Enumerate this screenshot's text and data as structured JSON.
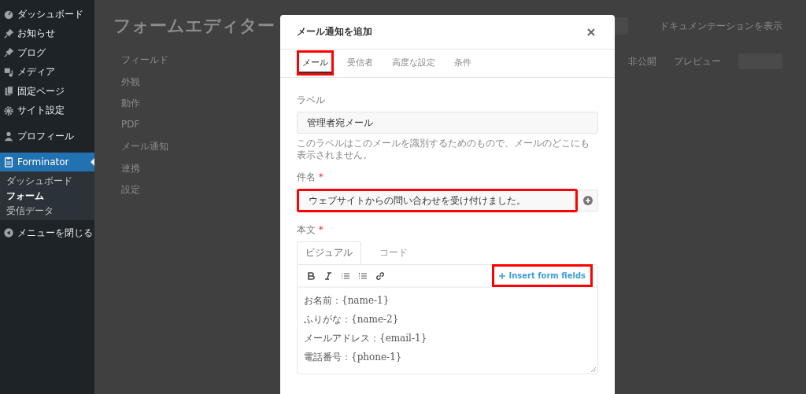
{
  "sidebar": {
    "items": [
      {
        "label": "ダッシュボード",
        "selected": false
      },
      {
        "label": "お知らせ",
        "selected": false
      },
      {
        "label": "ブログ",
        "selected": false
      },
      {
        "label": "メディア",
        "selected": false
      },
      {
        "label": "固定ページ",
        "selected": false
      },
      {
        "label": "サイト設定",
        "selected": false
      },
      {
        "label": "プロフィール",
        "selected": false
      },
      {
        "label": "Forminator",
        "selected": true,
        "children": [
          {
            "label": "ダッシュボード",
            "selected": false
          },
          {
            "label": "フォーム",
            "selected": true
          },
          {
            "label": "受信データ",
            "selected": false
          }
        ]
      }
    ],
    "collapse": "メニューを閉じる"
  },
  "page": {
    "title": "フォームエディター",
    "doc_link": "ドキュメンテーションを表示",
    "nav": [
      "フィールド",
      "外観",
      "動作",
      "PDF",
      "メール通知",
      "連携",
      "設定"
    ],
    "status_items": [
      "非公開",
      "プレビュー"
    ]
  },
  "modal": {
    "title": "メール通知を追加",
    "tabs": [
      {
        "label": "メール",
        "selected": true,
        "highlighted": true
      },
      {
        "label": "受信者",
        "selected": false,
        "highlighted": false
      },
      {
        "label": "高度な設定",
        "selected": false,
        "highlighted": false
      },
      {
        "label": "条件",
        "selected": false,
        "highlighted": false
      }
    ],
    "label_field": {
      "label": "ラベル",
      "value": "管理者宛メール",
      "help": "このラベルはこのメールを識別するためのもので、メールのどこにも表示されません。"
    },
    "subject_field": {
      "label": "件名",
      "required_mark": "*",
      "value": "ウェブサイトからの問い合わせを受け付けました。",
      "highlighted": true
    },
    "body_field": {
      "label": "本文",
      "required_mark": "*",
      "editor_tabs": [
        {
          "label": "ビジュアル",
          "selected": true
        },
        {
          "label": "コード",
          "selected": false
        }
      ],
      "insert_button": {
        "label": "Insert form fields",
        "highlighted": true
      },
      "lines": [
        "お名前：{name-1}",
        "ふりがな：{name-2}",
        "メールアドレス：{email-1}",
        "電話番号：{phone-1}"
      ]
    }
  }
}
